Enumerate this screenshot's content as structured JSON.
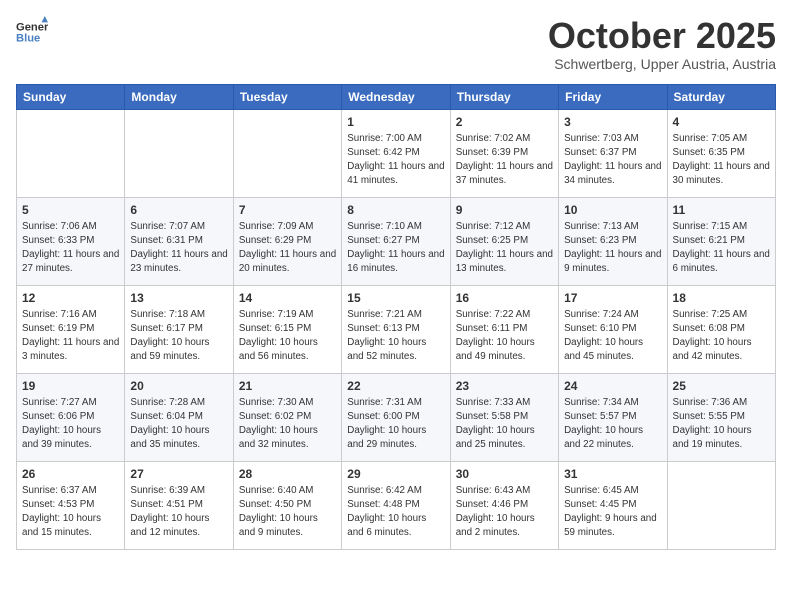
{
  "header": {
    "logo_general": "General",
    "logo_blue": "Blue",
    "month_title": "October 2025",
    "subtitle": "Schwertberg, Upper Austria, Austria"
  },
  "calendar": {
    "days_of_week": [
      "Sunday",
      "Monday",
      "Tuesday",
      "Wednesday",
      "Thursday",
      "Friday",
      "Saturday"
    ],
    "weeks": [
      [
        {
          "day": "",
          "info": ""
        },
        {
          "day": "",
          "info": ""
        },
        {
          "day": "",
          "info": ""
        },
        {
          "day": "1",
          "info": "Sunrise: 7:00 AM\nSunset: 6:42 PM\nDaylight: 11 hours and 41 minutes."
        },
        {
          "day": "2",
          "info": "Sunrise: 7:02 AM\nSunset: 6:39 PM\nDaylight: 11 hours and 37 minutes."
        },
        {
          "day": "3",
          "info": "Sunrise: 7:03 AM\nSunset: 6:37 PM\nDaylight: 11 hours and 34 minutes."
        },
        {
          "day": "4",
          "info": "Sunrise: 7:05 AM\nSunset: 6:35 PM\nDaylight: 11 hours and 30 minutes."
        }
      ],
      [
        {
          "day": "5",
          "info": "Sunrise: 7:06 AM\nSunset: 6:33 PM\nDaylight: 11 hours and 27 minutes."
        },
        {
          "day": "6",
          "info": "Sunrise: 7:07 AM\nSunset: 6:31 PM\nDaylight: 11 hours and 23 minutes."
        },
        {
          "day": "7",
          "info": "Sunrise: 7:09 AM\nSunset: 6:29 PM\nDaylight: 11 hours and 20 minutes."
        },
        {
          "day": "8",
          "info": "Sunrise: 7:10 AM\nSunset: 6:27 PM\nDaylight: 11 hours and 16 minutes."
        },
        {
          "day": "9",
          "info": "Sunrise: 7:12 AM\nSunset: 6:25 PM\nDaylight: 11 hours and 13 minutes."
        },
        {
          "day": "10",
          "info": "Sunrise: 7:13 AM\nSunset: 6:23 PM\nDaylight: 11 hours and 9 minutes."
        },
        {
          "day": "11",
          "info": "Sunrise: 7:15 AM\nSunset: 6:21 PM\nDaylight: 11 hours and 6 minutes."
        }
      ],
      [
        {
          "day": "12",
          "info": "Sunrise: 7:16 AM\nSunset: 6:19 PM\nDaylight: 11 hours and 3 minutes."
        },
        {
          "day": "13",
          "info": "Sunrise: 7:18 AM\nSunset: 6:17 PM\nDaylight: 10 hours and 59 minutes."
        },
        {
          "day": "14",
          "info": "Sunrise: 7:19 AM\nSunset: 6:15 PM\nDaylight: 10 hours and 56 minutes."
        },
        {
          "day": "15",
          "info": "Sunrise: 7:21 AM\nSunset: 6:13 PM\nDaylight: 10 hours and 52 minutes."
        },
        {
          "day": "16",
          "info": "Sunrise: 7:22 AM\nSunset: 6:11 PM\nDaylight: 10 hours and 49 minutes."
        },
        {
          "day": "17",
          "info": "Sunrise: 7:24 AM\nSunset: 6:10 PM\nDaylight: 10 hours and 45 minutes."
        },
        {
          "day": "18",
          "info": "Sunrise: 7:25 AM\nSunset: 6:08 PM\nDaylight: 10 hours and 42 minutes."
        }
      ],
      [
        {
          "day": "19",
          "info": "Sunrise: 7:27 AM\nSunset: 6:06 PM\nDaylight: 10 hours and 39 minutes."
        },
        {
          "day": "20",
          "info": "Sunrise: 7:28 AM\nSunset: 6:04 PM\nDaylight: 10 hours and 35 minutes."
        },
        {
          "day": "21",
          "info": "Sunrise: 7:30 AM\nSunset: 6:02 PM\nDaylight: 10 hours and 32 minutes."
        },
        {
          "day": "22",
          "info": "Sunrise: 7:31 AM\nSunset: 6:00 PM\nDaylight: 10 hours and 29 minutes."
        },
        {
          "day": "23",
          "info": "Sunrise: 7:33 AM\nSunset: 5:58 PM\nDaylight: 10 hours and 25 minutes."
        },
        {
          "day": "24",
          "info": "Sunrise: 7:34 AM\nSunset: 5:57 PM\nDaylight: 10 hours and 22 minutes."
        },
        {
          "day": "25",
          "info": "Sunrise: 7:36 AM\nSunset: 5:55 PM\nDaylight: 10 hours and 19 minutes."
        }
      ],
      [
        {
          "day": "26",
          "info": "Sunrise: 6:37 AM\nSunset: 4:53 PM\nDaylight: 10 hours and 15 minutes."
        },
        {
          "day": "27",
          "info": "Sunrise: 6:39 AM\nSunset: 4:51 PM\nDaylight: 10 hours and 12 minutes."
        },
        {
          "day": "28",
          "info": "Sunrise: 6:40 AM\nSunset: 4:50 PM\nDaylight: 10 hours and 9 minutes."
        },
        {
          "day": "29",
          "info": "Sunrise: 6:42 AM\nSunset: 4:48 PM\nDaylight: 10 hours and 6 minutes."
        },
        {
          "day": "30",
          "info": "Sunrise: 6:43 AM\nSunset: 4:46 PM\nDaylight: 10 hours and 2 minutes."
        },
        {
          "day": "31",
          "info": "Sunrise: 6:45 AM\nSunset: 4:45 PM\nDaylight: 9 hours and 59 minutes."
        },
        {
          "day": "",
          "info": ""
        }
      ]
    ]
  }
}
